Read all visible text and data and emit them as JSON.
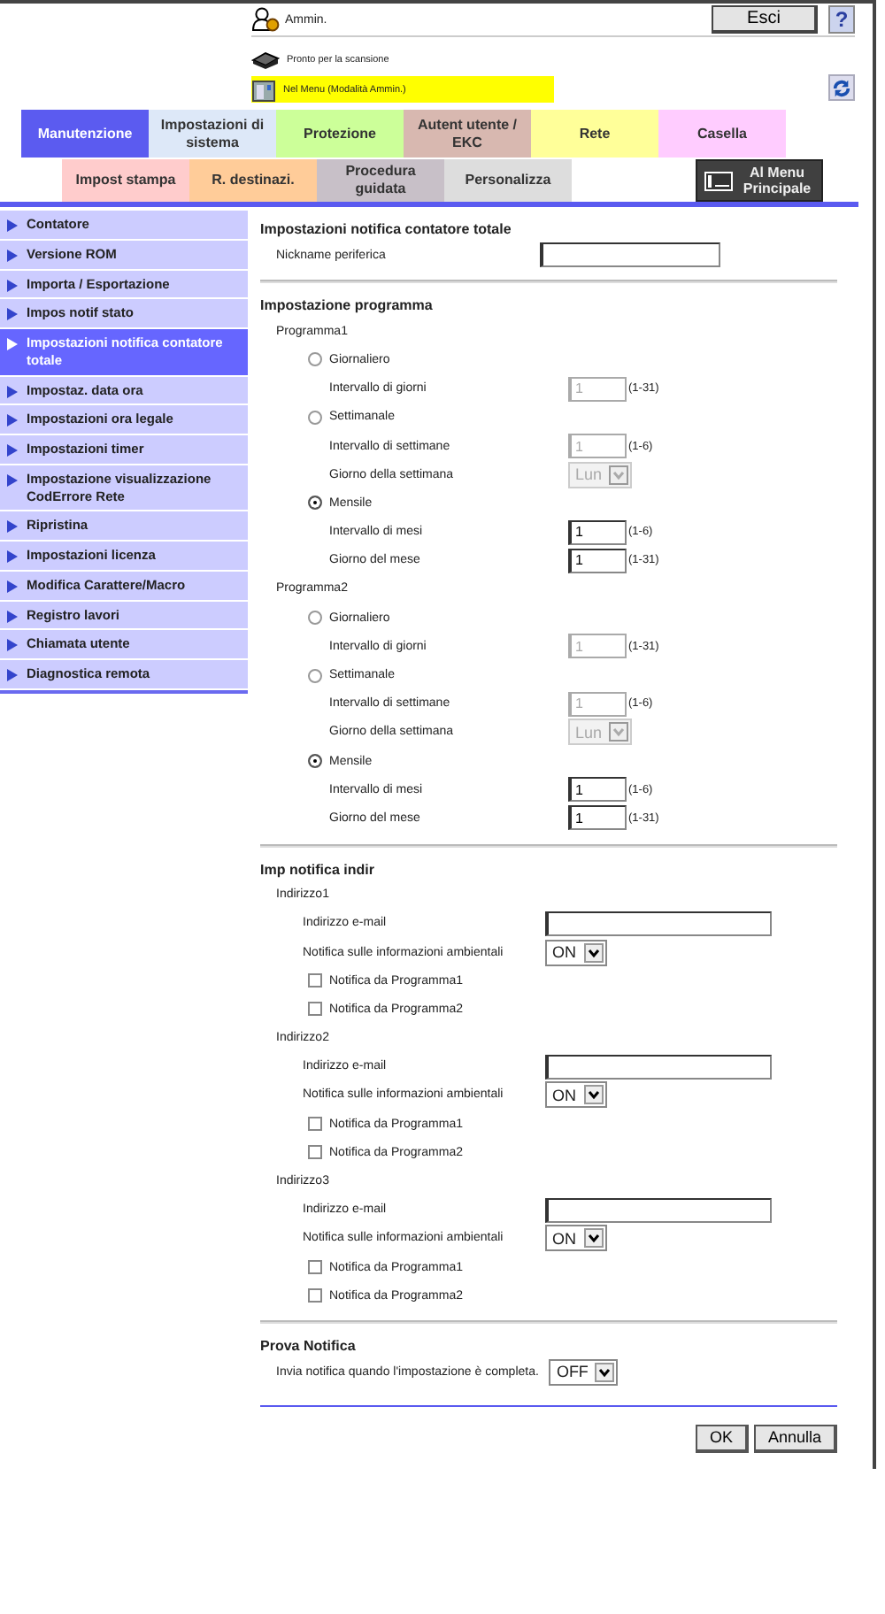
{
  "header": {
    "user": "Ammin.",
    "logout": "Esci",
    "help": "?",
    "status_lines": [
      {
        "kind": "scanner",
        "text": "Pronto per la scansione",
        "highlighted": false
      },
      {
        "kind": "machine",
        "text": "Nel Menu (Modalità Ammin.)",
        "highlighted": true
      }
    ]
  },
  "tabs": [
    {
      "label": "Manutenzione",
      "selected": true,
      "color": "#5b5bf0"
    },
    {
      "label": "Impostazioni di sistema",
      "selected": false,
      "color": "#dde8f8"
    },
    {
      "label": "Protezione",
      "selected": false,
      "color": "#ccff99"
    },
    {
      "label": "Autent utente / EKC",
      "selected": false,
      "color": "#d8b8b0"
    },
    {
      "label": "Rete",
      "selected": false,
      "color": "#ffff99"
    },
    {
      "label": "Casella",
      "selected": false,
      "color": "#ffccff"
    }
  ],
  "subtabs": [
    {
      "label": "Impost stampa",
      "selected": false,
      "color": "#ffcccc"
    },
    {
      "label": "R. destinazi.",
      "selected": false,
      "color": "#ffcc99"
    },
    {
      "label": "Procedura guidata",
      "selected": false,
      "color": "#c8c0c8"
    },
    {
      "label": "Personalizza",
      "selected": false,
      "color": "#dddddd"
    }
  ],
  "main_menu_button": "Al Menu Principale",
  "sidebar": {
    "items": [
      {
        "label": "Contatore",
        "selected": false
      },
      {
        "label": "Versione ROM",
        "selected": false
      },
      {
        "label": "Importa / Esportazione",
        "selected": false
      },
      {
        "label": "Impos notif stato",
        "selected": false
      },
      {
        "label": "Impostazioni notifica contatore totale",
        "selected": true
      },
      {
        "label": "Impostaz. data ora",
        "selected": false
      },
      {
        "label": "Impostazioni ora legale",
        "selected": false
      },
      {
        "label": "Impostazioni timer",
        "selected": false
      },
      {
        "label": "Impostazione visualizzazione CodErrore Rete",
        "selected": false
      },
      {
        "label": "Ripristina",
        "selected": false
      },
      {
        "label": "Impostazioni licenza",
        "selected": false
      },
      {
        "label": "Modifica Carattere/Macro",
        "selected": false
      },
      {
        "label": "Registro lavori",
        "selected": false
      },
      {
        "label": "Chiamata utente",
        "selected": false
      },
      {
        "label": "Diagnostica remota",
        "selected": false
      }
    ]
  },
  "device": {
    "title": "Impostazioni notifica contatore totale",
    "nickname_label": "Nickname periferica"
  },
  "schedule": {
    "title": "Impostazione programma",
    "programs": [
      {
        "label": "Programma1",
        "options": [
          {
            "label": "Giornaliero",
            "selected": false,
            "fields": [
              {
                "kind": "number",
                "label": "Intervallo di giorni",
                "value": "1",
                "range": "(1-31)",
                "disabled": true
              }
            ]
          },
          {
            "label": "Settimanale",
            "selected": false,
            "fields": [
              {
                "kind": "number",
                "label": "Intervallo di settimane",
                "value": "1",
                "range": "(1-6)",
                "disabled": true
              },
              {
                "kind": "select",
                "label": "Giorno della settimana",
                "value": "Lun",
                "disabled": true
              }
            ]
          },
          {
            "label": "Mensile",
            "selected": true,
            "fields": [
              {
                "kind": "number",
                "label": "Intervallo di mesi",
                "value": "1",
                "range": "(1-6)",
                "disabled": false
              },
              {
                "kind": "number",
                "label": "Giorno del mese",
                "value": "1",
                "range": "(1-31)",
                "disabled": false
              }
            ]
          }
        ]
      },
      {
        "label": "Programma2",
        "options": [
          {
            "label": "Giornaliero",
            "selected": false,
            "fields": [
              {
                "kind": "number",
                "label": "Intervallo di giorni",
                "value": "1",
                "range": "(1-31)",
                "disabled": true
              }
            ]
          },
          {
            "label": "Settimanale",
            "selected": false,
            "fields": [
              {
                "kind": "number",
                "label": "Intervallo di settimane",
                "value": "1",
                "range": "(1-6)",
                "disabled": true
              },
              {
                "kind": "select",
                "label": "Giorno della settimana",
                "value": "Lun",
                "disabled": true
              }
            ]
          },
          {
            "label": "Mensile",
            "selected": true,
            "fields": [
              {
                "kind": "number",
                "label": "Intervallo di mesi",
                "value": "1",
                "range": "(1-6)",
                "disabled": false
              },
              {
                "kind": "number",
                "label": "Giorno del mese",
                "value": "1",
                "range": "(1-31)",
                "disabled": false
              }
            ]
          }
        ]
      }
    ]
  },
  "addresses": {
    "title": "Imp notifica indir",
    "items": [
      {
        "label": "Indirizzo1",
        "email_label": "Indirizzo e-mail",
        "env_label": "Notifica sulle informazioni ambientali",
        "env_value": "ON",
        "checkboxes": [
          {
            "label": "Notifica da Programma1",
            "checked": false
          },
          {
            "label": "Notifica da Programma2",
            "checked": false
          }
        ]
      },
      {
        "label": "Indirizzo2",
        "email_label": "Indirizzo e-mail",
        "env_label": "Notifica sulle informazioni ambientali",
        "env_value": "ON",
        "checkboxes": [
          {
            "label": "Notifica da Programma1",
            "checked": false
          },
          {
            "label": "Notifica da Programma2",
            "checked": false
          }
        ]
      },
      {
        "label": "Indirizzo3",
        "email_label": "Indirizzo e-mail",
        "env_label": "Notifica sulle informazioni ambientali",
        "env_value": "ON",
        "checkboxes": [
          {
            "label": "Notifica da Programma1",
            "checked": false
          },
          {
            "label": "Notifica da Programma2",
            "checked": false
          }
        ]
      }
    ]
  },
  "test": {
    "title": "Prova Notifica",
    "label": "Invia notifica quando l'impostazione è completa.",
    "value": "OFF"
  },
  "buttons": [
    "OK",
    "Annulla"
  ]
}
